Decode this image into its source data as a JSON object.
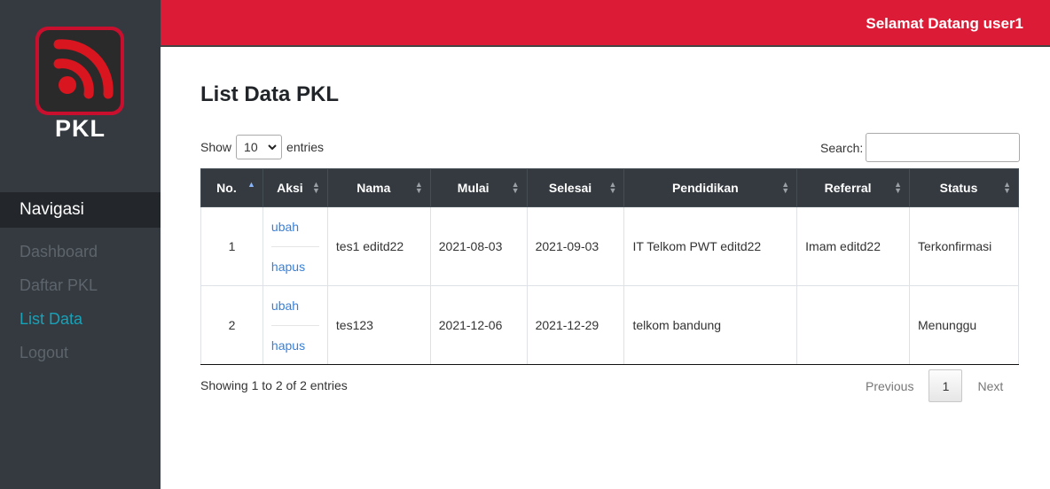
{
  "sidebar": {
    "logo_text": "PKL",
    "nav_header": "Navigasi",
    "items": [
      {
        "label": "Dashboard"
      },
      {
        "label": "Daftar PKL"
      },
      {
        "label": "List Data"
      },
      {
        "label": "Logout"
      }
    ]
  },
  "header": {
    "welcome": "Selamat Datang user1"
  },
  "colors": {
    "brand_red": "#dc1b36",
    "sidebar_bg": "#343a40",
    "active_nav": "#17a2b8",
    "link": "#3a7fd5"
  },
  "main": {
    "title": "List Data PKL",
    "length": {
      "show": "Show",
      "value": "10",
      "entries": "entries"
    },
    "search": {
      "label": "Search:",
      "value": ""
    },
    "columns": [
      "No.",
      "Aksi",
      "Nama",
      "Mulai",
      "Selesai",
      "Pendidikan",
      "Referral",
      "Status"
    ],
    "rows": [
      {
        "no": "1",
        "edit": "ubah",
        "delete": "hapus",
        "nama": "tes1 editd22",
        "mulai": "2021-08-03",
        "selesai": "2021-09-03",
        "pendidikan": "IT Telkom PWT editd22",
        "referral": "Imam editd22",
        "status": "Terkonfirmasi"
      },
      {
        "no": "2",
        "edit": "ubah",
        "delete": "hapus",
        "nama": "tes123",
        "mulai": "2021-12-06",
        "selesai": "2021-12-29",
        "pendidikan": "telkom bandung",
        "referral": "",
        "status": "Menunggu"
      }
    ],
    "info": "Showing 1 to 2 of 2 entries",
    "pagination": {
      "previous": "Previous",
      "page": "1",
      "next": "Next"
    }
  }
}
